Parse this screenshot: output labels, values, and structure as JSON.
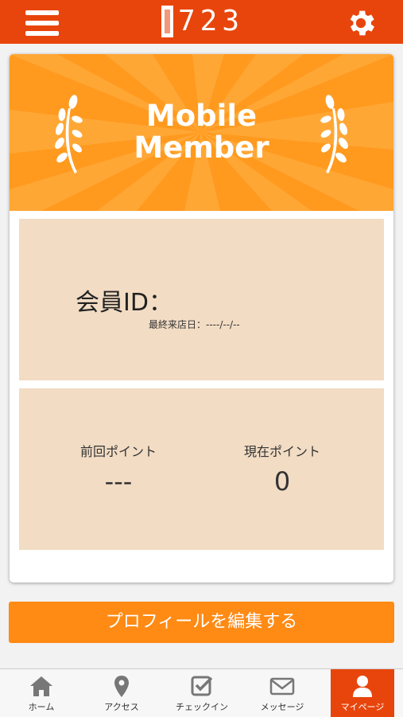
{
  "header": {
    "logo_text": "723",
    "menu_icon": "hamburger-menu-icon",
    "settings_icon": "gear-icon",
    "brand_color": "#e8450c"
  },
  "banner": {
    "line1": "Mobile",
    "line2": "Member",
    "color": "#ff9a1f"
  },
  "member": {
    "id_label": "会員ID：",
    "last_visit": "最終来店日：----/--/--"
  },
  "points": {
    "previous_label": "前回ポイント",
    "previous_value": "---",
    "current_label": "現在ポイント",
    "current_value": "0"
  },
  "edit_profile_button": "プロフィールを編集する",
  "tabs": [
    {
      "label": "ホーム",
      "icon": "home-icon",
      "active": false
    },
    {
      "label": "アクセス",
      "icon": "map-pin-icon",
      "active": false
    },
    {
      "label": "チェックイン",
      "icon": "checkin-icon",
      "active": false
    },
    {
      "label": "メッセージ",
      "icon": "envelope-icon",
      "active": false
    },
    {
      "label": "マイページ",
      "icon": "user-icon",
      "active": true
    }
  ]
}
